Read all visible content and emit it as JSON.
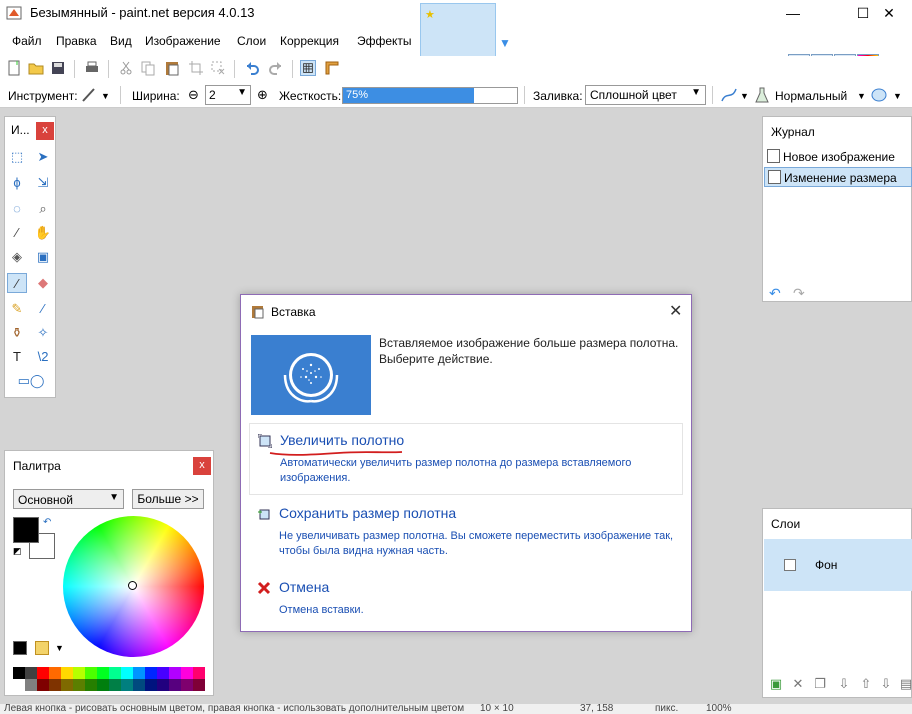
{
  "window": {
    "title": "Безымянный - paint.net версия 4.0.13",
    "min": "—",
    "max": "☐",
    "close": "✕"
  },
  "menu": [
    "Файл",
    "Правка",
    "Вид",
    "Изображение",
    "Слои",
    "Коррекция",
    "Эффекты"
  ],
  "options": {
    "tool_label": "Инструмент:",
    "width_label": "Ширина:",
    "width_value": "2",
    "hardness_label": "Жесткость:",
    "hardness_value": "75%",
    "hardness_percent": 75,
    "fill_label": "Заливка:",
    "fill_value": "Сплошной цвет",
    "blend_value": "Нормальный",
    "minus": "⊖",
    "plus": "⊕"
  },
  "tools": {
    "title": "И...",
    "close": "x"
  },
  "palette": {
    "title": "Палитра",
    "close": "x",
    "mode": "Основной",
    "more_button": "Больше >>",
    "colors_row1": [
      "#000000",
      "#404040",
      "#ff0000",
      "#ff6a00",
      "#ffd800",
      "#b6ff00",
      "#4cff00",
      "#00ff21",
      "#00ff90",
      "#00ffff",
      "#0094ff",
      "#0026ff",
      "#4800ff",
      "#b200ff",
      "#ff00dc",
      "#ff006e"
    ],
    "colors_row2": [
      "#ffffff",
      "#808080",
      "#7f0000",
      "#7f3300",
      "#7f6a00",
      "#5b7f00",
      "#267f00",
      "#007f0e",
      "#007f46",
      "#007f7f",
      "#004a7f",
      "#00137f",
      "#21007f",
      "#57007f",
      "#7f006e",
      "#7f0037"
    ]
  },
  "history": {
    "title": "Журнал",
    "items": [
      "Новое изображение",
      "Изменение размера"
    ],
    "undo": "↶",
    "redo": "↷"
  },
  "layers": {
    "title": "Слои",
    "layer_name": "Фон"
  },
  "status": {
    "text": "Левая кнопка - рисовать основным цветом, правая кнопка - использовать дополнительным цветом",
    "size": "10 × 10",
    "coords": "37, 158",
    "units": "пикс.",
    "zoom": "100%"
  },
  "dialog": {
    "title": "Вставка",
    "close": "✕",
    "message": "Вставляемое изображение больше размера полотна. Выберите действие.",
    "enlarge_title": "Увеличить полотно",
    "enlarge_desc": "Автоматически увеличить размер полотна до размера вставляемого изображения.",
    "keep_title": "Сохранить размер полотна",
    "keep_desc": "Не увеличивать размер полотна. Вы сможете переместить изображение так, чтобы была видна нужная часть.",
    "cancel_title": "Отмена",
    "cancel_desc": "Отмена вставки."
  }
}
